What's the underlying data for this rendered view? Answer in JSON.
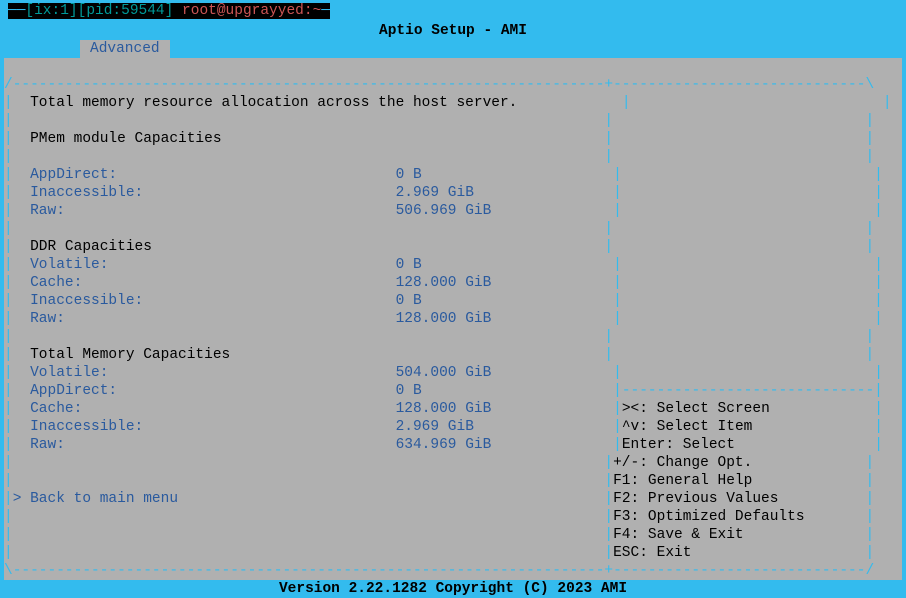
{
  "titlebar": {
    "session": "[ix:1][pid:59544]",
    "userhost": "root@upgrayyed:~"
  },
  "header": {
    "title": "Aptio Setup - AMI"
  },
  "tab": {
    "label": "Advanced"
  },
  "main": {
    "desc": "Total memory resource allocation across the host server.",
    "section1": "PMem module Capacities",
    "pmem": {
      "appdirect_label": "AppDirect:",
      "appdirect_value": "0 B",
      "inaccessible_label": "Inaccessible:",
      "inaccessible_value": "2.969 GiB",
      "raw_label": "Raw:",
      "raw_value": "506.969 GiB"
    },
    "section2": "DDR Capacities",
    "ddr": {
      "volatile_label": "Volatile:",
      "volatile_value": "0 B",
      "cache_label": "Cache:",
      "cache_value": "128.000 GiB",
      "inaccessible_label": "Inaccessible:",
      "inaccessible_value": "0 B",
      "raw_label": "Raw:",
      "raw_value": "128.000 GiB"
    },
    "section3": "Total Memory Capacities",
    "total": {
      "volatile_label": "Volatile:",
      "volatile_value": "504.000 GiB",
      "appdirect_label": "AppDirect:",
      "appdirect_value": "0 B",
      "cache_label": "Cache:",
      "cache_value": "128.000 GiB",
      "inaccessible_label": "Inaccessible:",
      "inaccessible_value": "2.969 GiB",
      "raw_label": "Raw:",
      "raw_value": "634.969 GiB"
    },
    "back": "Back to main menu"
  },
  "help": {
    "h1": "><: Select Screen",
    "h2": "^v: Select Item",
    "h3": "Enter: Select",
    "h4": "+/-: Change Opt.",
    "h5": "F1: General Help",
    "h6": "F2: Previous Values",
    "h7": "F3: Optimized Defaults",
    "h8": "F4: Save & Exit",
    "h9": "ESC: Exit"
  },
  "footer": {
    "version": "Version 2.22.1282 Copyright (C) 2023 AMI"
  }
}
